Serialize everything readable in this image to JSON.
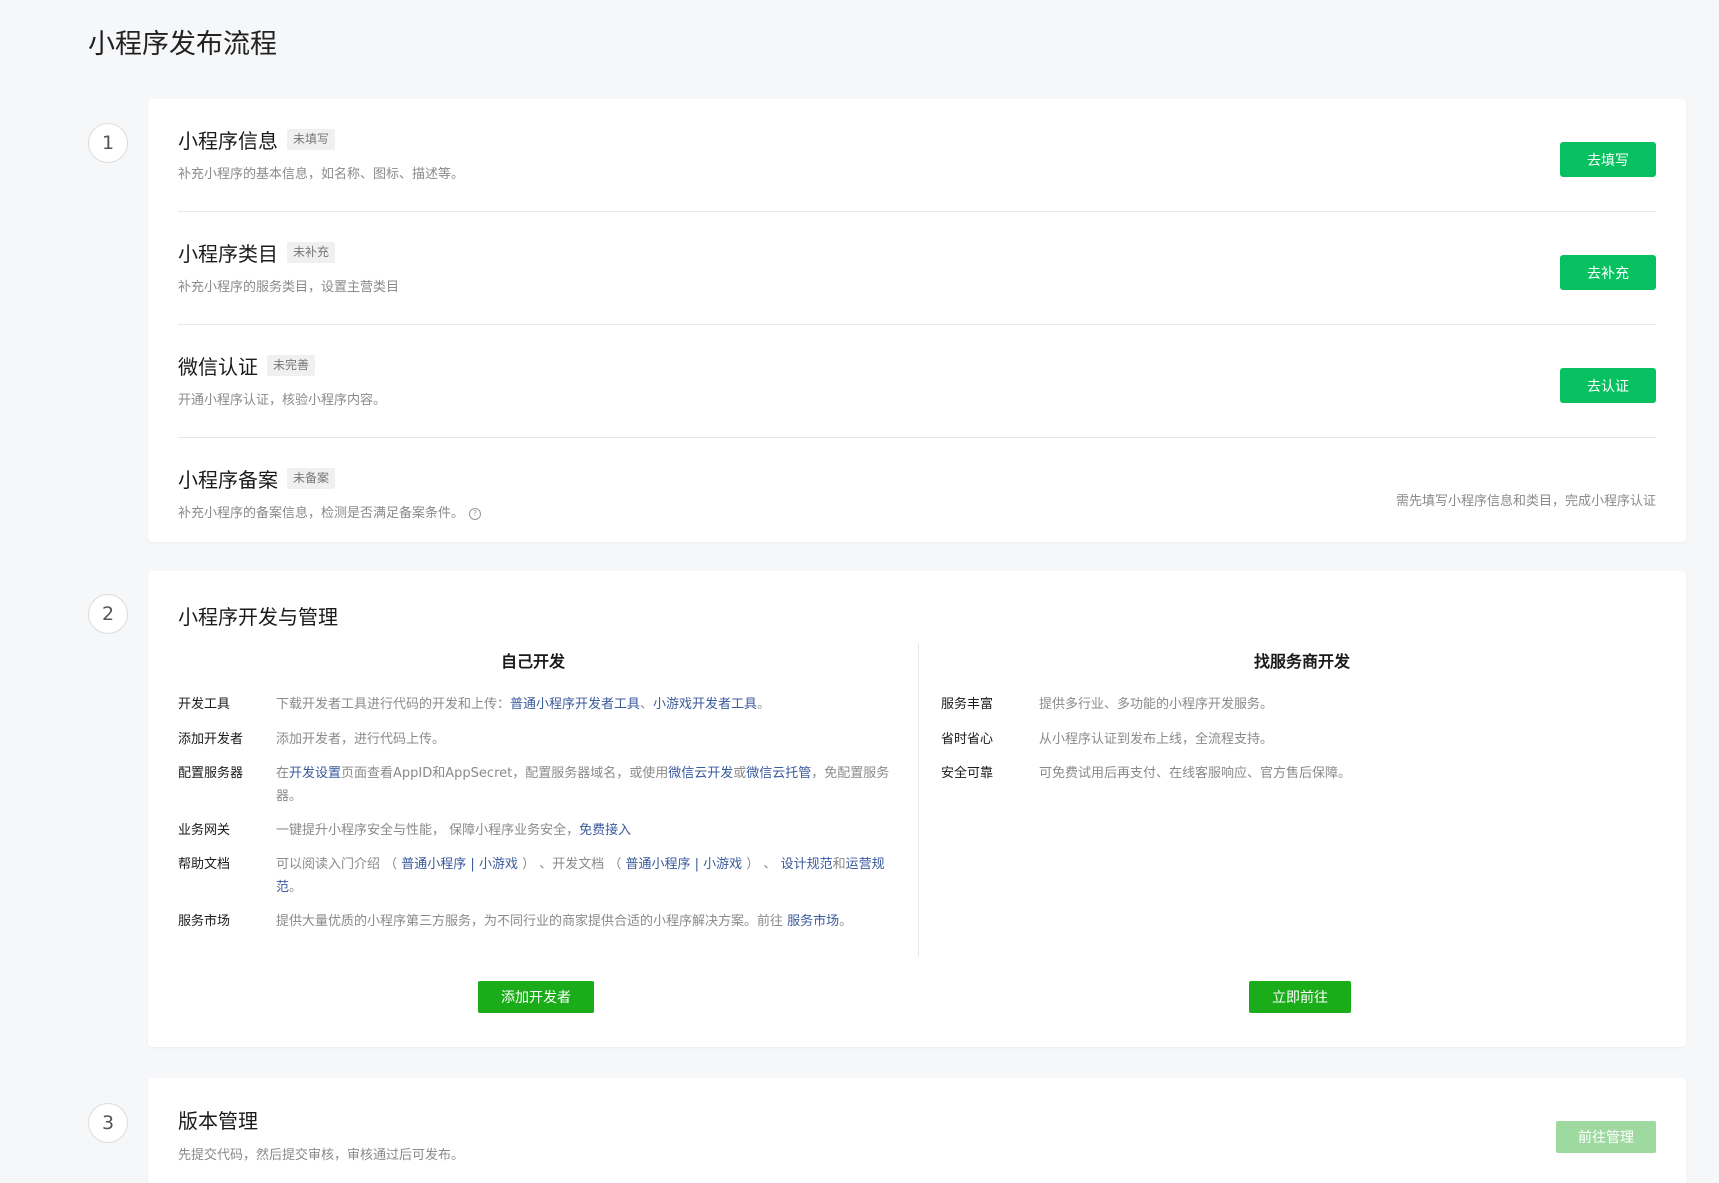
{
  "page": {
    "title": "小程序发布流程"
  },
  "steps": [
    "1",
    "2",
    "3"
  ],
  "info_card": {
    "rows": [
      {
        "title": "小程序信息",
        "tag": "未填写",
        "desc": "补充小程序的基本信息，如名称、图标、描述等。",
        "button": "去填写"
      },
      {
        "title": "小程序类目",
        "tag": "未补充",
        "desc": "补充小程序的服务类目，设置主营类目",
        "button": "去补充"
      },
      {
        "title": "微信认证",
        "tag": "未完善",
        "desc": "开通小程序认证，核验小程序内容。",
        "button": "去认证"
      },
      {
        "title": "小程序备案",
        "tag": "未备案",
        "desc": "补充小程序的备案信息，检测是否满足备案条件。",
        "help_icon": "?",
        "note": "需先填写小程序信息和类目，完成小程序认证"
      }
    ]
  },
  "dev_card": {
    "title": "小程序开发与管理",
    "left": {
      "heading": "自己开发",
      "items": {
        "tools": {
          "label": "开发工具",
          "text1": "下载开发者工具进行代码的开发和上传：",
          "link1": "普通小程序开发者工具",
          "sep1": "、",
          "link2": "小游戏开发者工具",
          "end": "。"
        },
        "add_dev": {
          "label": "添加开发者",
          "text1": "添加开发者，进行代码上传。"
        },
        "server": {
          "label": "配置服务器",
          "text1": "在",
          "link1": "开发设置",
          "text2": "页面查看AppID和AppSecret，配置服务器域名，或使用",
          "link2": "微信云开发",
          "text3": "或",
          "link3": "微信云托管",
          "text4": "，免配置服务器。"
        },
        "gateway": {
          "label": "业务网关",
          "text1": "一键提升小程序安全与性能，  保障小程序业务安全，",
          "link1": "免费接入"
        },
        "docs": {
          "label": "帮助文档",
          "text1": "可以阅读入门介绍 （ ",
          "link1": "普通小程序",
          "pipe1": " | ",
          "link2": "小游戏",
          "text2": " ） 、开发文档 （ ",
          "link3": "普通小程序",
          "pipe2": " | ",
          "link4": "小游戏",
          "text3": " ） 、 ",
          "link5": "设计规范",
          "text4": "和",
          "link6": "运营规范",
          "end": "。"
        },
        "market": {
          "label": "服务市场",
          "text1": "提供大量优质的小程序第三方服务，为不同行业的商家提供合适的小程序解决方案。前往 ",
          "link1": "服务市场",
          "end": "。"
        }
      },
      "button": "添加开发者"
    },
    "right": {
      "heading": "找服务商开发",
      "items": [
        {
          "label": "服务丰富",
          "text": "提供多行业、多功能的小程序开发服务。"
        },
        {
          "label": "省时省心",
          "text": "从小程序认证到发布上线，全流程支持。"
        },
        {
          "label": "安全可靠",
          "text": "可免费试用后再支付、在线客服响应、官方售后保障。"
        }
      ],
      "button": "立即前往"
    }
  },
  "version_card": {
    "title": "版本管理",
    "desc": "先提交代码，然后提交审核，审核通过后可发布。",
    "button": "前往管理"
  },
  "colors": {
    "primary": "#07c160",
    "link": "#3a5a9c",
    "background": "#f6f7f9"
  }
}
